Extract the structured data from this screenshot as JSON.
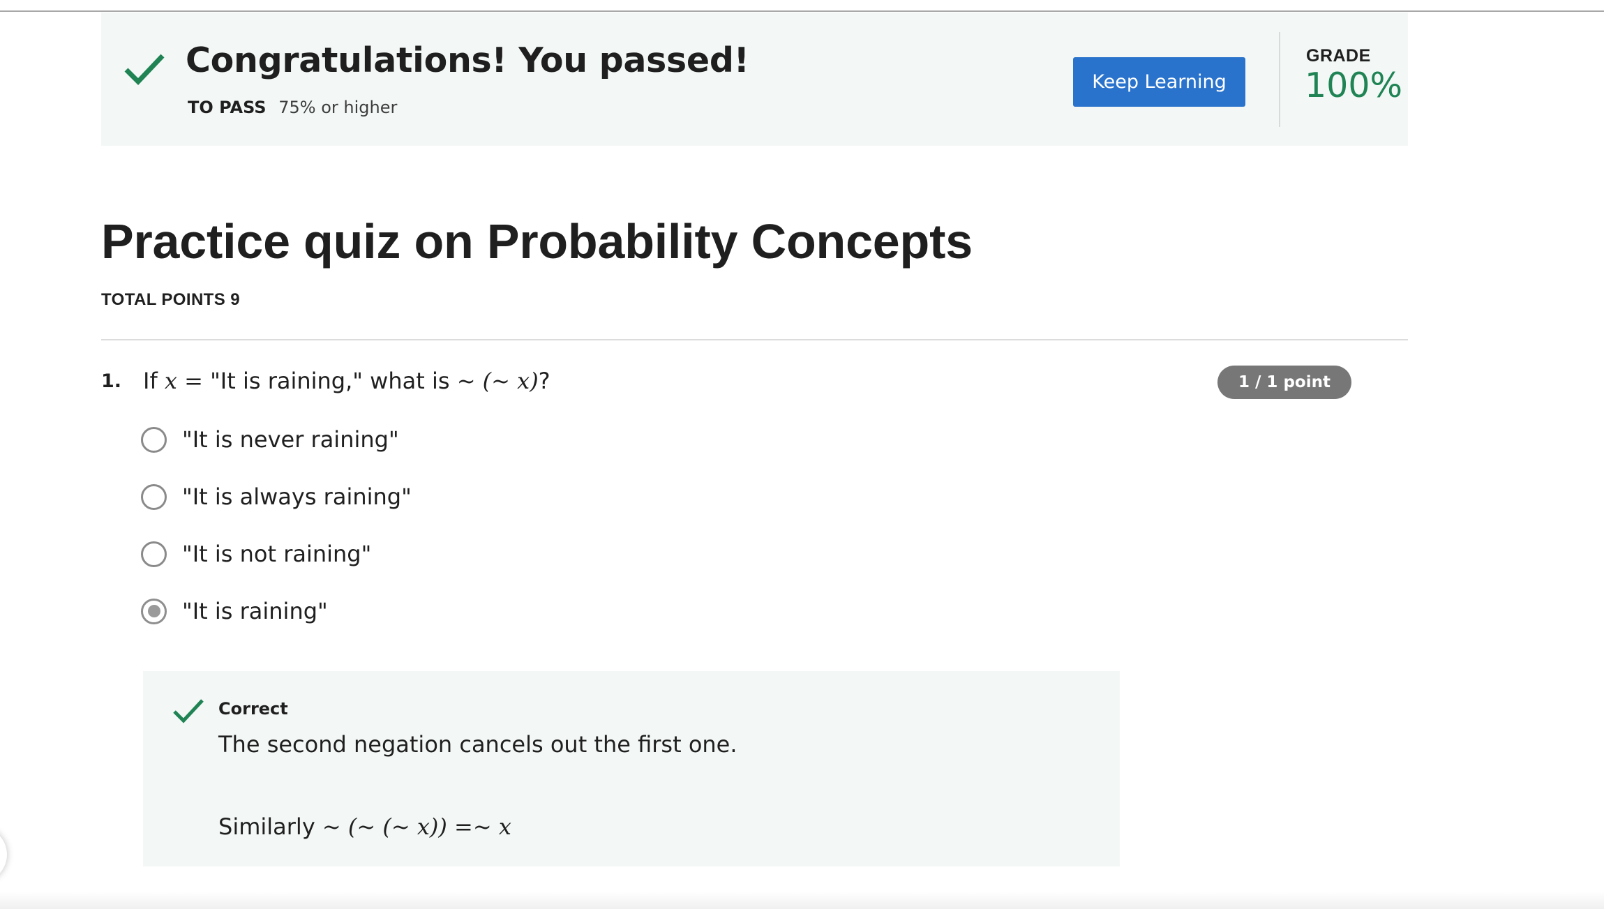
{
  "banner": {
    "title": "Congratulations! You passed!",
    "to_pass_label": "TO PASS",
    "to_pass_value": "75% or higher",
    "keep_learning_label": "Keep Learning",
    "grade_label": "GRADE",
    "grade_value": "100%"
  },
  "quiz": {
    "title": "Practice quiz on Probability Concepts",
    "total_points": "TOTAL POINTS 9"
  },
  "question": {
    "number": "1.",
    "text_prefix": "If ",
    "text_var": "x",
    "text_eq": " = ",
    "text_quote": "\"It is raining,\"",
    "text_mid": " what is ",
    "text_expr": "~ (~ x)",
    "text_suffix": "?",
    "points": "1 / 1 point",
    "options": [
      {
        "label": "\"It is never raining\"",
        "selected": false
      },
      {
        "label": "\"It is always raining\"",
        "selected": false
      },
      {
        "label": "\"It is not raining\"",
        "selected": false
      },
      {
        "label": "\"It is raining\"",
        "selected": true
      }
    ]
  },
  "feedback": {
    "label": "Correct",
    "text": "The second negation cancels out the first one.",
    "math_prefix": "Similarly ",
    "math_expr": "~ (~ (~ x)) =~ x"
  },
  "colors": {
    "accent_green": "#1f8354",
    "button_blue": "#2a73cc",
    "banner_bg": "#f3f8f6",
    "badge_gray": "#777777"
  },
  "icons": {
    "banner": "checkmark-icon",
    "feedback": "checkmark-icon"
  }
}
